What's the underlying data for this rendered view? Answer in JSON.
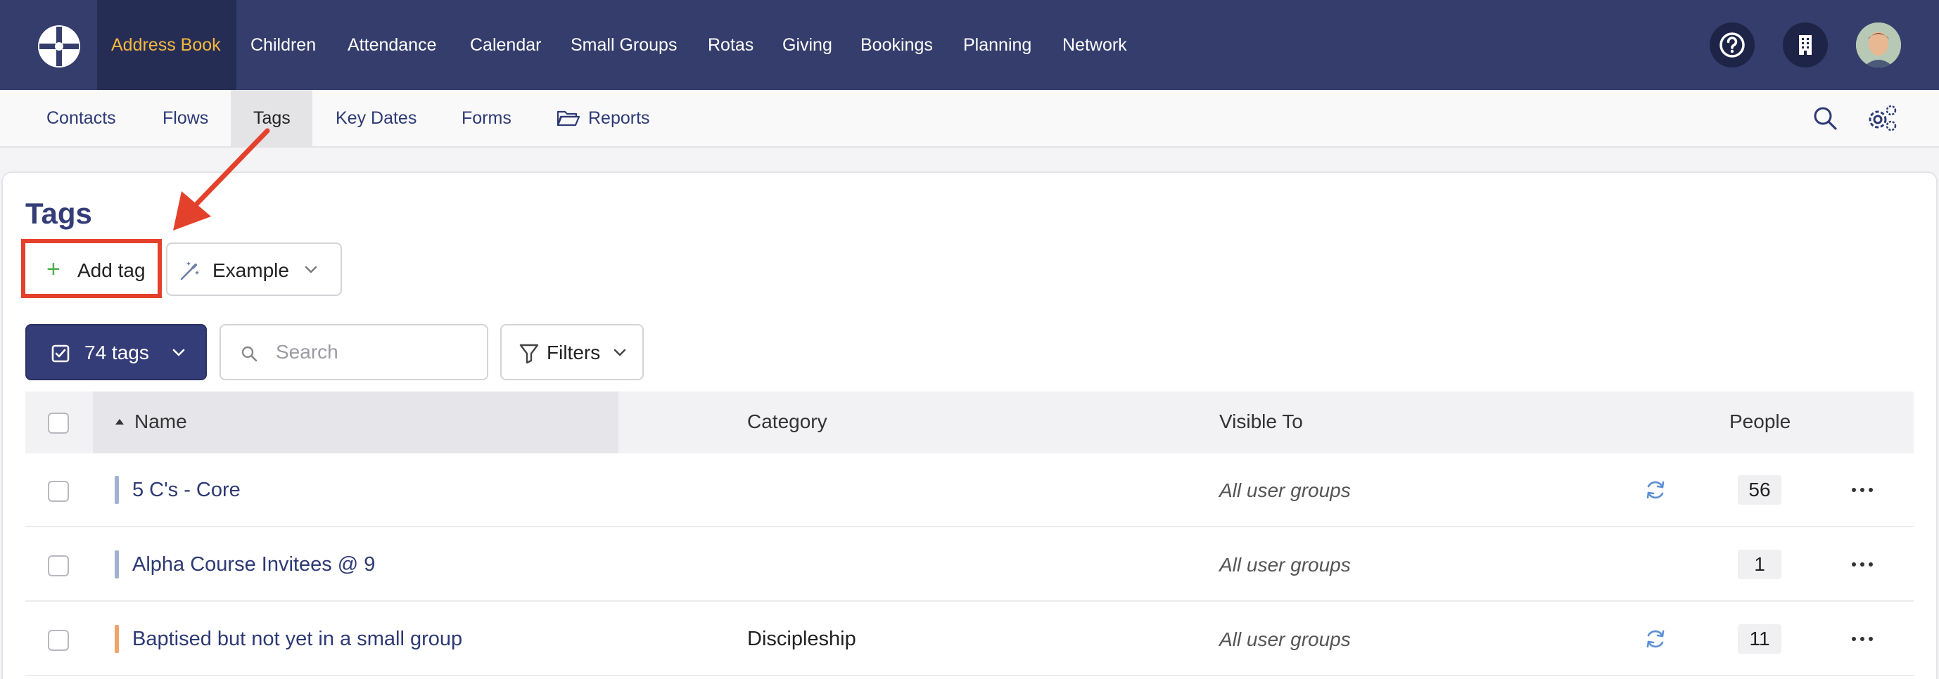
{
  "topnav": {
    "items": [
      {
        "label": "Address Book",
        "active": true
      },
      {
        "label": "Children"
      },
      {
        "label": "Attendance"
      },
      {
        "label": "Calendar"
      },
      {
        "label": "Small Groups"
      },
      {
        "label": "Rotas"
      },
      {
        "label": "Giving"
      },
      {
        "label": "Bookings"
      },
      {
        "label": "Planning"
      },
      {
        "label": "Network"
      }
    ],
    "active_color": "#f5b83d",
    "bg_color": "#343d6b"
  },
  "subnav": {
    "items": [
      {
        "label": "Contacts"
      },
      {
        "label": "Flows"
      },
      {
        "label": "Tags",
        "active": true
      },
      {
        "label": "Key Dates"
      },
      {
        "label": "Forms"
      },
      {
        "label": "Reports"
      }
    ]
  },
  "page": {
    "title": "Tags",
    "add_tag_label": "Add tag",
    "example_label": "Example",
    "tags_count_label": "74 tags",
    "search_placeholder": "Search",
    "filters_label": "Filters"
  },
  "table": {
    "headers": {
      "name": "Name",
      "category": "Category",
      "visible_to": "Visible To",
      "people": "People"
    },
    "rows": [
      {
        "name": "5 C's - Core",
        "category": "",
        "visible_to": "All user groups",
        "synced": true,
        "people": "56",
        "color": "#9fb3d1"
      },
      {
        "name": "Alpha Course Invitees @ 9",
        "category": "",
        "visible_to": "All user groups",
        "synced": false,
        "people": "1",
        "color": "#9fb3d1"
      },
      {
        "name": "Baptised but not yet in a small group",
        "category": "Discipleship",
        "visible_to": "All user groups",
        "synced": true,
        "people": "11",
        "color": "#f0a46a"
      }
    ]
  },
  "annotation_color": "#e4412c"
}
